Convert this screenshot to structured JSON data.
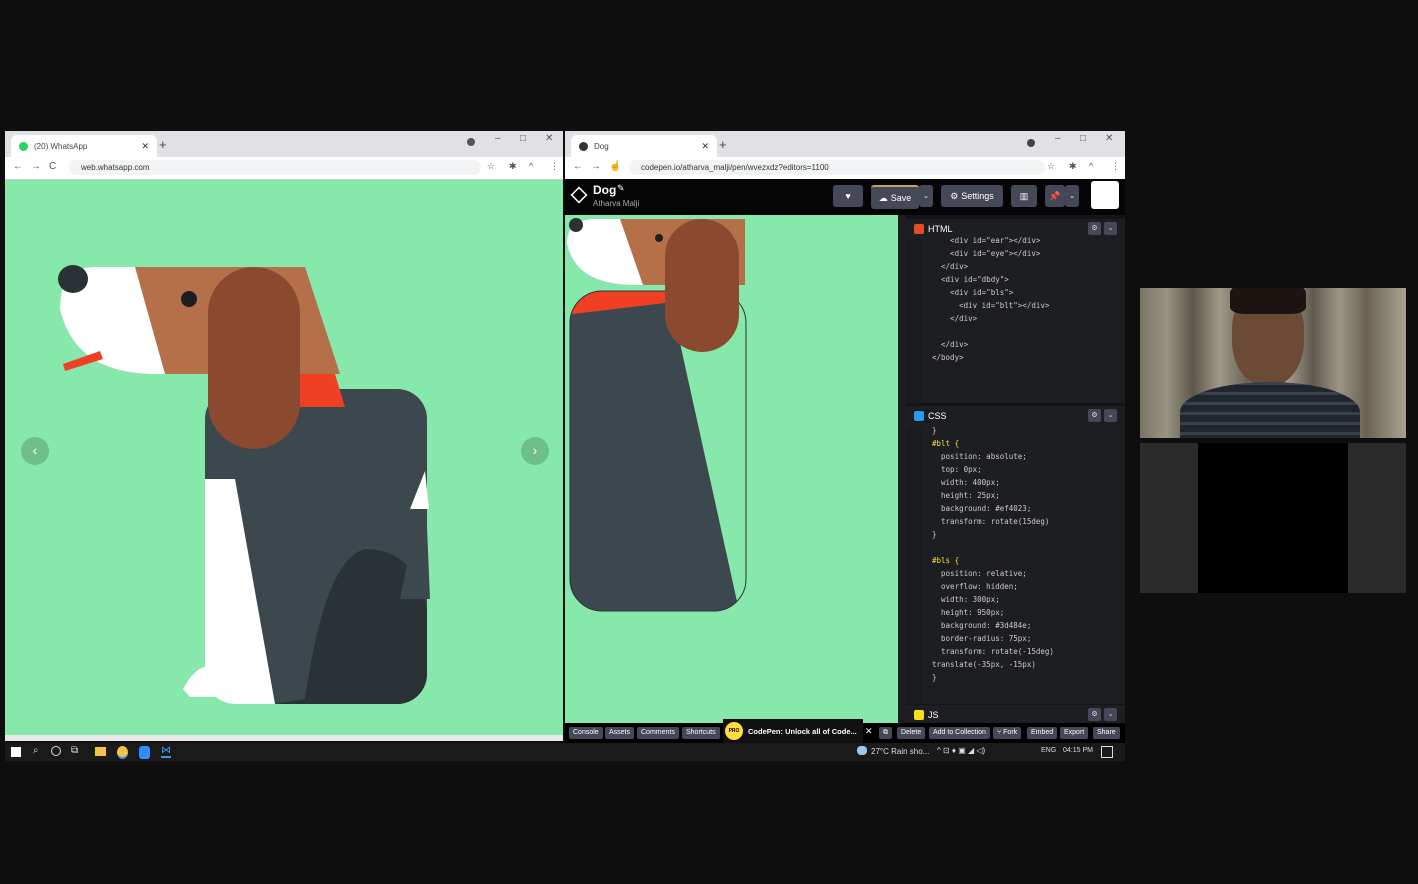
{
  "whatsapp_window": {
    "tab_title": "(20) WhatsApp",
    "url": "web.whatsapp.com",
    "prev_icon": "chevron-left-icon",
    "next_icon": "chevron-right-icon",
    "background": "#86e9ab"
  },
  "codepen_window": {
    "tab_title": "Dog",
    "url": "codepen.io/atharva_malji/pen/wvezxdz?editors=1100",
    "pen_title": "Dog",
    "author": "Atharva Malji",
    "buttons": {
      "save": "Save",
      "settings": "Settings"
    },
    "html_panel": {
      "label": "HTML",
      "lines": [
        "    <div id=\"ear\"></div>",
        "    <div id=\"eye\"></div>",
        "  </div>",
        "  <div id=\"dbdy\">",
        "    <div id=\"bls\">",
        "      <div id=\"blt\"></div>",
        "    </div>",
        "",
        "  </div>",
        "</body>"
      ]
    },
    "css_panel": {
      "label": "CSS",
      "lines": [
        "}",
        "#blt {",
        "  position: absolute;",
        "  top: 0px;",
        "  width: 400px;",
        "  height: 25px;",
        "  background: #ef4023;",
        "  transform: rotate(15deg)",
        "}",
        "",
        "#bls {",
        "  position: relative;",
        "  overflow: hidden;",
        "  width: 300px;",
        "  height: 950px;",
        "  background: #3d484e;",
        "  border-radius: 75px;",
        "  transform: rotate(-15deg)",
        "translate(-35px, -15px)",
        "}"
      ]
    },
    "js_panel": {
      "label": "JS"
    },
    "footer": {
      "console": "Console",
      "assets": "Assets",
      "comments": "Comments",
      "shortcuts": "Shortcuts",
      "pro_badge": "PRO",
      "promo": "CodePen: Unlock all of Code...",
      "delete": "Delete",
      "add_to_collection": "Add to Collection",
      "fork": "Fork",
      "embed": "Embed",
      "export": "Export",
      "share": "Share"
    }
  },
  "taskbar": {
    "weather": "27°C  Rain sho...",
    "language": "ENG",
    "time": "04:15 PM"
  },
  "colors": {
    "mint": "#86e9ab",
    "dog_body": "#3d484e",
    "collar": "#ef4023",
    "ear": "#8b4a2f",
    "head_tan": "#b5704a"
  }
}
